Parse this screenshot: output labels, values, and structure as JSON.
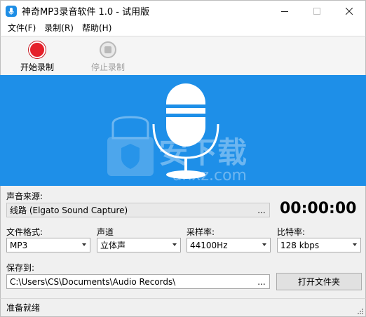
{
  "window": {
    "title": "神奇MP3录音软件 1.0 - 试用版",
    "icon": "microphone-app-icon",
    "controls": [
      "minimize-icon",
      "maximize-icon",
      "close-icon"
    ]
  },
  "menu": {
    "items": [
      {
        "label": "文件(F)"
      },
      {
        "label": "录制(R)"
      },
      {
        "label": "帮助(H)"
      }
    ]
  },
  "toolbar": {
    "start": {
      "label": "开始录制",
      "icon": "record-icon",
      "color": "#e5202a"
    },
    "stop": {
      "label": "停止录制",
      "icon": "stop-icon",
      "enabled": false
    }
  },
  "banner": {
    "color": "#1e8fe8",
    "icon": "microphone-icon",
    "watermark": "安下载 anxz.com"
  },
  "form": {
    "source_label": "声音来源:",
    "source_value": "线路 (Elgato Sound Capture)",
    "source_browse": "...",
    "timer": "00:00:00",
    "format_label": "文件格式:",
    "format_value": "MP3",
    "channel_label": "声道",
    "channel_value": "立体声",
    "samplerate_label": "采样率:",
    "samplerate_value": "44100Hz",
    "bitrate_label": "比特率:",
    "bitrate_value": "128 kbps",
    "save_label": "保存到:",
    "save_path": "C:\\Users\\CS\\Documents\\Audio Records\\",
    "save_browse": "...",
    "open_folder": "打开文件夹"
  },
  "status": {
    "text": "准备就绪"
  }
}
